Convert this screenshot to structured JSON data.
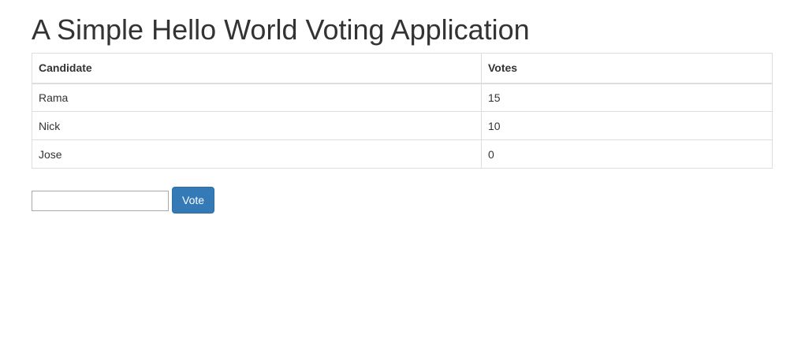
{
  "page": {
    "title": "A Simple Hello World Voting Application"
  },
  "table": {
    "headers": {
      "candidate": "Candidate",
      "votes": "Votes"
    },
    "rows": [
      {
        "candidate": "Rama",
        "votes": "15"
      },
      {
        "candidate": "Nick",
        "votes": "10"
      },
      {
        "candidate": "Jose",
        "votes": "0"
      }
    ]
  },
  "form": {
    "input_value": "",
    "input_placeholder": "",
    "vote_button_label": "Vote"
  },
  "colors": {
    "button_primary": "#337ab7",
    "text": "#333333",
    "table_border": "#dddddd"
  }
}
